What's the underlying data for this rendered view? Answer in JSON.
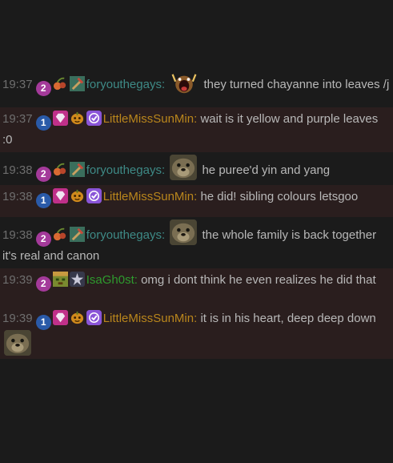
{
  "colors": {
    "background": "#1b1b1b",
    "highlight_row": "#2a1e1e",
    "timestamp": "#6e6e6e",
    "text": "#b8b8b8"
  },
  "messages": [
    {
      "time": "19:37",
      "sub_months": "2",
      "user": "foryouthegays",
      "colon": ":",
      "user_color": "#3e8a86",
      "badges": [
        "sub-badge-2",
        "cherry-badge",
        "pickaxe-badge"
      ],
      "emote": "screaming-emote",
      "text": "they turned chayanne into leaves /j",
      "highlight": false
    },
    {
      "time": "19:37",
      "sub_months": "1",
      "user": "LittleMissSunMin",
      "colon": ":",
      "user_color": "#b9861c",
      "badges": [
        "sub-badge-1",
        "gem-badge",
        "pumpkin-badge",
        "verified-badge"
      ],
      "emote": "",
      "text": "wait is it yellow and purple leaves :0",
      "highlight": true
    },
    {
      "time": "19:38",
      "sub_months": "2",
      "user": "foryouthegays",
      "colon": ":",
      "user_color": "#3e8a86",
      "badges": [
        "sub-badge-2",
        "cherry-badge",
        "pickaxe-badge"
      ],
      "emote": "otter-emote",
      "text": "he puree'd yin and yang",
      "highlight": false
    },
    {
      "time": "19:38",
      "sub_months": "1",
      "user": "LittleMissSunMin",
      "colon": ":",
      "user_color": "#b9861c",
      "badges": [
        "sub-badge-1",
        "gem-badge",
        "pumpkin-badge",
        "verified-badge"
      ],
      "emote": "",
      "text": "he did! sibling colours letsgoo",
      "highlight": true
    },
    {
      "time": "19:38",
      "sub_months": "2",
      "user": "foryouthegays",
      "colon": ":",
      "user_color": "#3e8a86",
      "badges": [
        "sub-badge-2",
        "cherry-badge",
        "pickaxe-badge"
      ],
      "emote": "otter-emote",
      "text": "the whole family is back together it's real and canon",
      "highlight": false
    },
    {
      "time": "19:39",
      "sub_months": "2",
      "user": "IsaGh0st",
      "colon": ":",
      "user_color": "#2e9a2e",
      "badges": [
        "sub-badge-2",
        "minecraft-face-badge",
        "star-badge"
      ],
      "emote": "",
      "text": "omg i dont think he even realizes he did that",
      "highlight": true
    },
    {
      "time": "19:39",
      "sub_months": "1",
      "user": "LittleMissSunMin",
      "colon": ":",
      "user_color": "#b9861c",
      "badges": [
        "sub-badge-1",
        "gem-badge",
        "pumpkin-badge",
        "verified-badge"
      ],
      "emote": "otter-emote",
      "emote_position": "end",
      "text": "it is in his heart, deep deep down",
      "highlight": true
    }
  ]
}
